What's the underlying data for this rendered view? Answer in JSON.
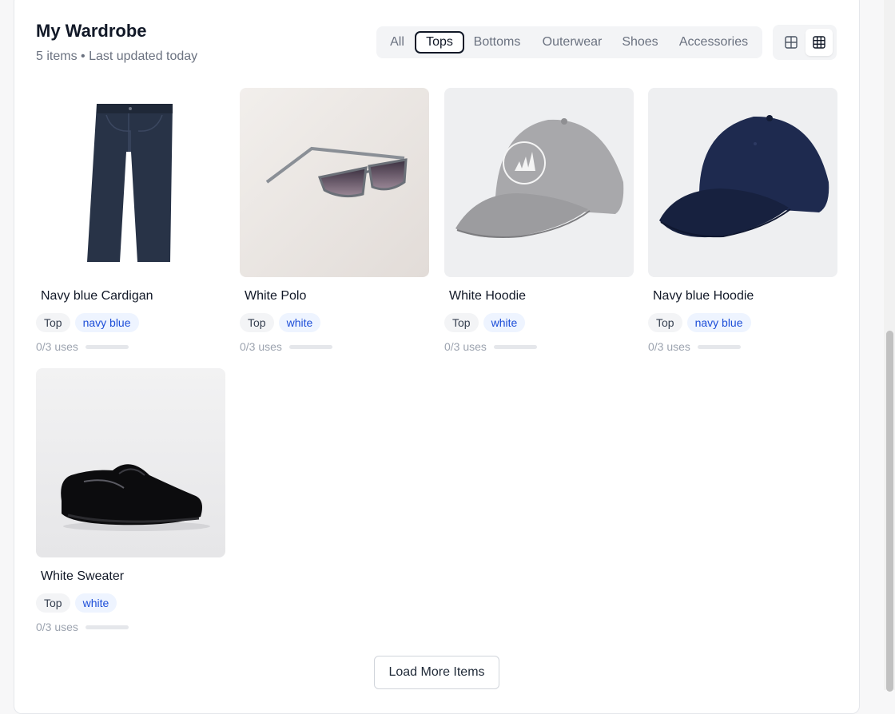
{
  "header": {
    "title": "My Wardrobe",
    "subtitle": "5 items • Last updated today"
  },
  "filters": {
    "items": [
      "All",
      "Tops",
      "Bottoms",
      "Outerwear",
      "Shoes",
      "Accessories"
    ],
    "selected": "Tops"
  },
  "view_toggle": {
    "options": [
      "large-grid",
      "compact-grid"
    ],
    "selected": "compact-grid"
  },
  "items": [
    {
      "name": "Navy blue Cardigan",
      "type": "Top",
      "color": "navy blue",
      "uses": "0/3 uses",
      "usage_fraction": 0,
      "image": "navy jeans"
    },
    {
      "name": "White Polo",
      "type": "Top",
      "color": "white",
      "uses": "0/3 uses",
      "usage_fraction": 0,
      "image": "sunglasses"
    },
    {
      "name": "White Hoodie",
      "type": "Top",
      "color": "white",
      "uses": "0/3 uses",
      "usage_fraction": 0,
      "image": "grey cap"
    },
    {
      "name": "Navy blue Hoodie",
      "type": "Top",
      "color": "navy blue",
      "uses": "0/3 uses",
      "usage_fraction": 0,
      "image": "navy cap"
    },
    {
      "name": "White Sweater",
      "type": "Top",
      "color": "white",
      "uses": "0/3 uses",
      "usage_fraction": 0,
      "image": "black patent shoe"
    }
  ],
  "load_more_label": "Load More Items",
  "colors": {
    "accent": "#111827",
    "tag_color_bg": "#eef4ff",
    "tag_color_text": "#1d4ed8",
    "tag_type_bg": "#f3f4f6"
  }
}
